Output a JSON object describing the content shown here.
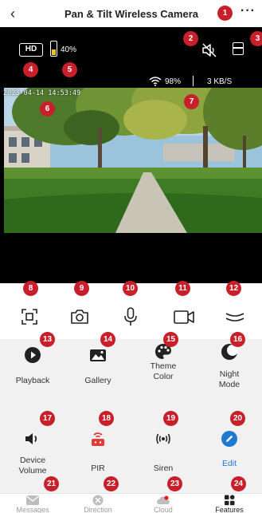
{
  "header": {
    "back_label": "‹",
    "title": "Pan & Tilt Wireless Camera",
    "more_label": "···"
  },
  "video": {
    "quality_label": "HD",
    "battery_level": 0.4,
    "battery_text": "40%",
    "wifi_signal": "98%",
    "transfer_speed": "3 KB/S",
    "timestamp": "2023-04-14 14:53:49",
    "sound": "muted"
  },
  "controls": {
    "items": [
      {
        "name": "fullscreen",
        "icon": "fullscreen-icon"
      },
      {
        "name": "screenshot",
        "icon": "camera-icon"
      },
      {
        "name": "talk",
        "icon": "microphone-icon"
      },
      {
        "name": "record",
        "icon": "video-record-icon"
      },
      {
        "name": "collapse",
        "icon": "chevron-double-icon"
      }
    ]
  },
  "features": {
    "playback": {
      "label": "Playback",
      "icon": "play-icon"
    },
    "gallery": {
      "label": "Gallery",
      "icon": "image-icon"
    },
    "theme_color": {
      "label": "Theme\nColor",
      "icon": "palette-icon"
    },
    "night_mode": {
      "label": "Night\nMode",
      "icon": "moon-icon"
    },
    "device_volume": {
      "label": "Device\nVolume",
      "icon": "speaker-icon"
    },
    "pir": {
      "label": "PIR",
      "icon": "pir-sensor-icon"
    },
    "siren": {
      "label": "Siren",
      "icon": "siren-icon"
    },
    "edit": {
      "label": "Edit",
      "icon": "edit-icon"
    }
  },
  "tabs": {
    "messages": "Messages",
    "direction": "Direction",
    "cloud": "Cloud",
    "features": "Features",
    "active": "features"
  },
  "badges": [
    "1",
    "2",
    "3",
    "4",
    "5",
    "6",
    "7",
    "8",
    "9",
    "10",
    "11",
    "12",
    "13",
    "14",
    "15",
    "16",
    "17",
    "18",
    "19",
    "20",
    "21",
    "22",
    "23",
    "24"
  ],
  "colors": {
    "badge": "#c8202a",
    "accent_blue": "#1f78d1",
    "pir_red": "#e03b3b",
    "battery_yellow": "#f2c318",
    "panel_bg": "#f1f1f1"
  }
}
